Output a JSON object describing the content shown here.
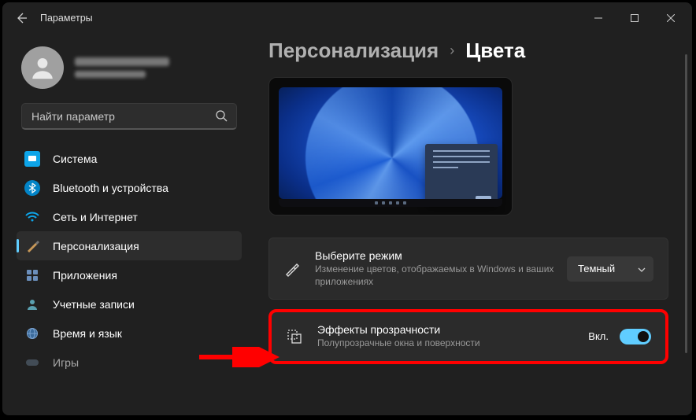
{
  "window": {
    "title": "Параметры"
  },
  "user": {
    "name": "█████████",
    "email": "███████"
  },
  "search": {
    "placeholder": "Найти параметр"
  },
  "nav": [
    {
      "label": "Система",
      "icon": "display"
    },
    {
      "label": "Bluetooth и устройства",
      "icon": "bluetooth"
    },
    {
      "label": "Сеть и Интернет",
      "icon": "wifi"
    },
    {
      "label": "Персонализация",
      "icon": "brush",
      "active": true
    },
    {
      "label": "Приложения",
      "icon": "apps"
    },
    {
      "label": "Учетные записи",
      "icon": "account"
    },
    {
      "label": "Время и язык",
      "icon": "globe"
    },
    {
      "label": "Игры",
      "icon": "games"
    }
  ],
  "breadcrumb": {
    "parent": "Персонализация",
    "current": "Цвета"
  },
  "settings": {
    "mode": {
      "title": "Выберите режим",
      "subtitle": "Изменение цветов, отображаемых в Windows и ваших приложениях",
      "value": "Темный"
    },
    "transparency": {
      "title": "Эффекты прозрачности",
      "subtitle": "Полупрозрачные окна и поверхности",
      "state_label": "Вкл.",
      "enabled": true
    }
  }
}
